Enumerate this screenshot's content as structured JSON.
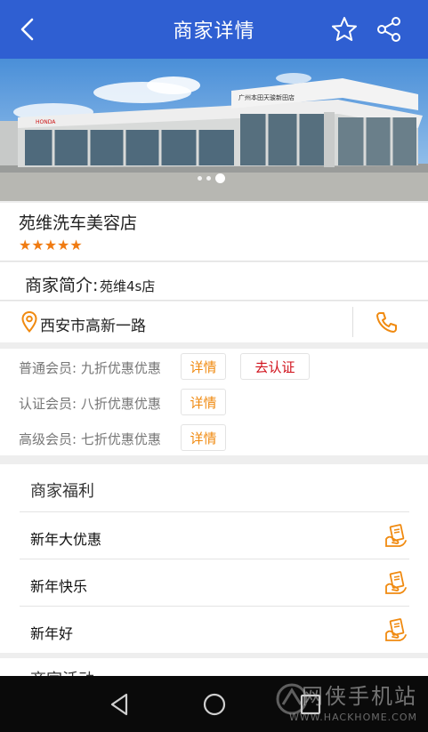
{
  "header": {
    "title": "商家详情",
    "back_icon": "back-arrow-icon",
    "star_icon": "star-outline-icon",
    "share_icon": "share-icon"
  },
  "banner": {
    "sign_text": "广州本田天骏新田店",
    "logo_text": "HONDA",
    "slide_count": 3,
    "active_slide": 3
  },
  "shop": {
    "name": "苑维洗车美容店",
    "stars": "★★★★★",
    "rating": 5
  },
  "intro": {
    "label": "商家简介:",
    "value": "苑维4s店"
  },
  "address": {
    "text": "西安市高新一路",
    "pin_icon": "location-pin-icon",
    "phone_icon": "phone-icon"
  },
  "membership": [
    {
      "text": "普通会员: 九折优惠优惠",
      "detail": "详情",
      "action": "去认证"
    },
    {
      "text": "认证会员: 八折优惠优惠",
      "detail": "详情"
    },
    {
      "text": "高级会员: 七折优惠优惠",
      "detail": "详情"
    }
  ],
  "benefits": {
    "title": "商家福利",
    "items": [
      {
        "label": "新年大优惠",
        "icon": "coupon-hand-icon"
      },
      {
        "label": "新年快乐",
        "icon": "coupon-hand-icon"
      },
      {
        "label": "新年好",
        "icon": "coupon-hand-icon"
      }
    ]
  },
  "next_section": {
    "title": "商家活动"
  },
  "navbar": {
    "back_icon": "nav-back-icon",
    "home_icon": "nav-home-icon",
    "recent_icon": "nav-recent-icon"
  },
  "watermark": {
    "text": "网侠手机站",
    "url": "WWW.HACKHOME.COM"
  },
  "colors": {
    "header": "#2f5fd2",
    "accent": "#f08a10",
    "stars": "#f07b12",
    "auth_button": "#d0101a"
  }
}
